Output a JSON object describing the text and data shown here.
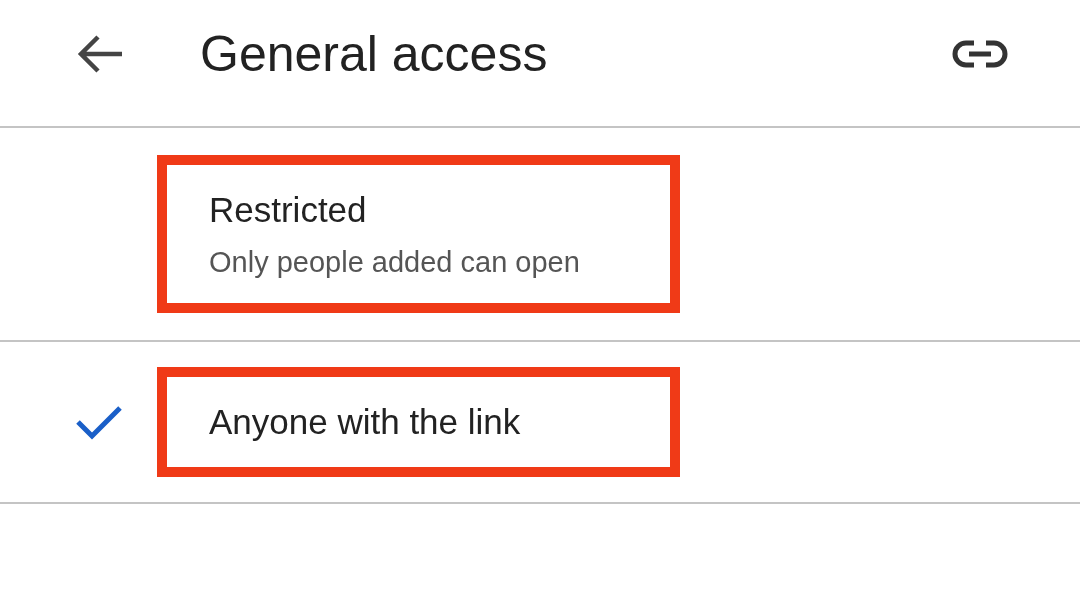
{
  "header": {
    "title": "General access"
  },
  "options": [
    {
      "label": "Restricted",
      "description": "Only people added can open",
      "selected": false,
      "highlighted": true
    },
    {
      "label": "Anyone with the link",
      "selected": true,
      "highlighted": true
    }
  ]
}
